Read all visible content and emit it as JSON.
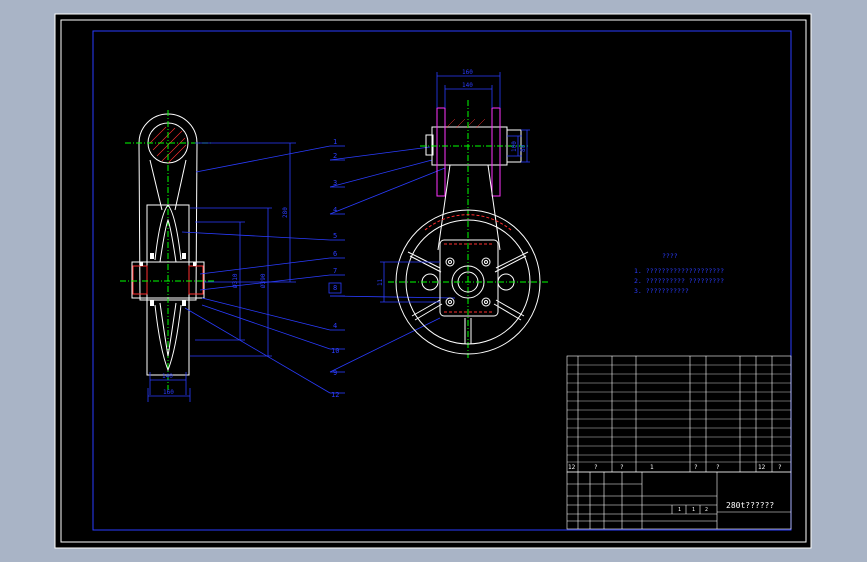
{
  "colors": {
    "background_outer": "#a9b4c6",
    "paper": "#000000",
    "frame": "#ffffff",
    "outline": "#ffffff",
    "dimension": "#2a3cff",
    "centerline": "#00ff00",
    "hidden": "#ff3030",
    "flange": "#ff33ff"
  },
  "drawing": {
    "title": "280t??????",
    "dim_width_small": "140",
    "dim_width_large": "160",
    "dim_top_outer": "160",
    "dim_top_inner": "140",
    "dim_vertical": "280",
    "dim_side": "11",
    "dim_right_a": "80",
    "dim_right_b": "100",
    "dim_dia_1": "Ø310",
    "dim_dia_2": "Ø390"
  },
  "balloons": [
    "1",
    "2",
    "3",
    "4",
    "5",
    "6",
    "7",
    "8",
    "4",
    "10",
    "9",
    "12"
  ],
  "notes": {
    "heading": "????",
    "lines": [
      "1. ????????????????????",
      "2. ?????????? ?????????",
      "3. ???????????"
    ]
  },
  "title_block": {
    "parts_row": [
      "12",
      "?",
      "?",
      "1",
      "",
      "?",
      "?",
      "12",
      "?"
    ],
    "drawing_title": "280t??????",
    "scale_cells": [
      "1",
      "1",
      "2"
    ]
  }
}
